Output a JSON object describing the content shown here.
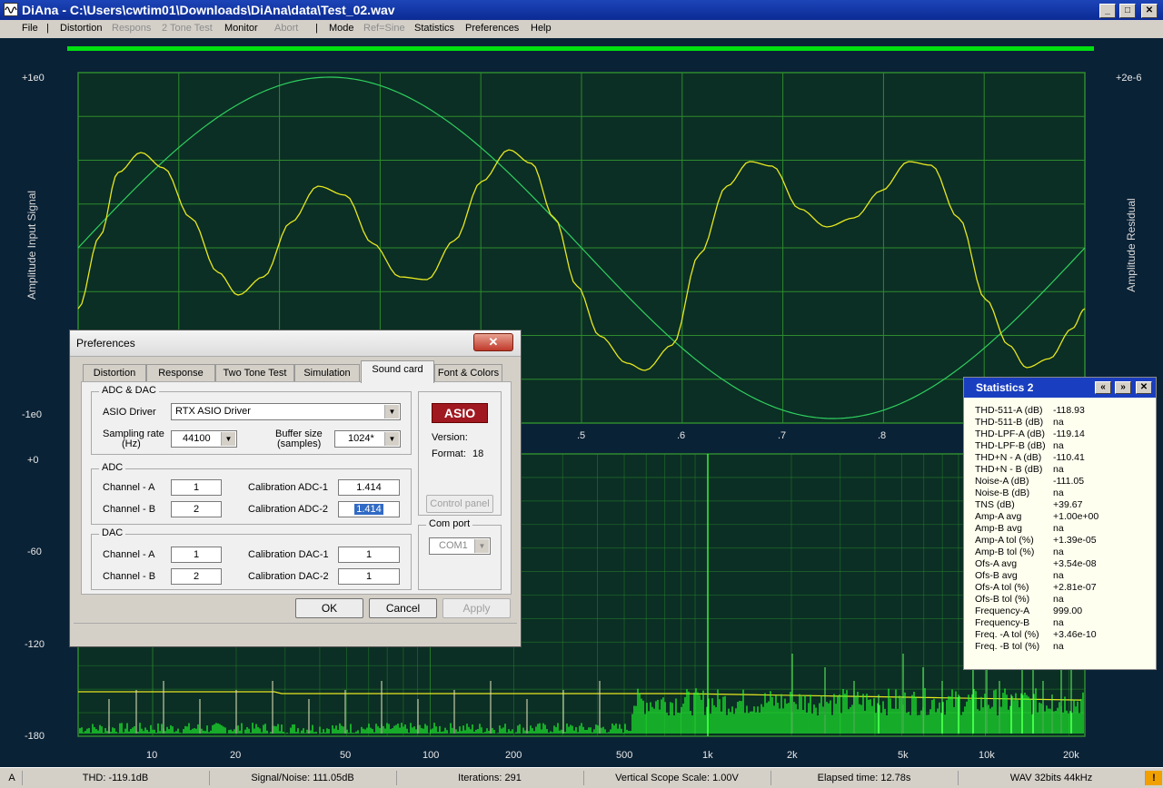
{
  "window": {
    "title": "DiAna - C:\\Users\\cwtim01\\Downloads\\DiAna\\data\\Test_02.wav"
  },
  "menu": [
    {
      "label": "File",
      "enabled": true
    },
    {
      "label": "|",
      "enabled": true
    },
    {
      "label": "Distortion",
      "enabled": true
    },
    {
      "label": "Respons",
      "enabled": false
    },
    {
      "label": "2 Tone Test",
      "enabled": false
    },
    {
      "label": "Monitor",
      "enabled": true
    },
    {
      "label": "Abort",
      "enabled": false
    },
    {
      "label": "|",
      "enabled": true
    },
    {
      "label": "Mode",
      "enabled": true
    },
    {
      "label": "Ref=Sine",
      "enabled": false
    },
    {
      "label": "Statistics",
      "enabled": true
    },
    {
      "label": "Preferences",
      "enabled": true
    },
    {
      "label": "Help",
      "enabled": true
    }
  ],
  "scope": {
    "y_top": "+1e0",
    "y_bottom": "-1e0",
    "y_right_top": "+2e-6",
    "left_label": "Amplitude Input Signal",
    "right_label": "Amplitude Residual",
    "x_ticks": [
      ".5",
      ".6",
      ".7",
      ".8"
    ]
  },
  "spectrum": {
    "y_ticks": [
      "+0",
      "-60",
      "-120",
      "-180"
    ],
    "x_ticks": [
      "10",
      "20",
      "50",
      "100",
      "200",
      "500",
      "1k",
      "2k",
      "5k",
      "10k",
      "20k"
    ]
  },
  "preferences": {
    "title": "Preferences",
    "tabs": [
      "Distortion",
      "Response",
      "Two Tone Test",
      "Simulation",
      "Sound card",
      "Font & Colors"
    ],
    "active_tab": "Sound card",
    "adc_dac_group": "ADC & DAC",
    "asio_driver_label": "ASIO Driver",
    "asio_driver_value": "RTX ASIO Driver",
    "sampling_rate_label": "Sampling rate",
    "sampling_rate_unit": "(Hz)",
    "sampling_rate_value": "44100",
    "buffer_size_label": "Buffer size",
    "buffer_size_unit": "(samples)",
    "buffer_size_value": "1024*",
    "adc_group": "ADC",
    "adc_channel_a_label": "Channel - A",
    "adc_channel_a_value": "1",
    "adc_channel_b_label": "Channel - B",
    "adc_channel_b_value": "2",
    "cal_adc1_label": "Calibration ADC-1",
    "cal_adc1_value": "1.414",
    "cal_adc2_label": "Calibration ADC-2",
    "cal_adc2_value": "1.414",
    "dac_group": "DAC",
    "dac_channel_a_label": "Channel - A",
    "dac_channel_a_value": "1",
    "dac_channel_b_label": "Channel - B",
    "dac_channel_b_value": "2",
    "cal_dac1_label": "Calibration DAC-1",
    "cal_dac1_value": "1",
    "cal_dac2_label": "Calibration DAC-2",
    "cal_dac2_value": "1",
    "asio_logo": "ASIO",
    "version_label": "Version:",
    "format_label": "Format:",
    "format_value": "18",
    "control_panel_label": "Control panel",
    "com_port_label": "Com port",
    "com_port_value": "COM1",
    "ok_label": "OK",
    "cancel_label": "Cancel",
    "apply_label": "Apply"
  },
  "statistics": {
    "title": "Statistics 2",
    "rows": [
      {
        "k": "THD-511-A (dB)",
        "v": "-118.93"
      },
      {
        "k": "THD-511-B (dB)",
        "v": "na"
      },
      {
        "k": "THD-LPF-A (dB)",
        "v": "-119.14"
      },
      {
        "k": "THD-LPF-B (dB)",
        "v": "na"
      },
      {
        "k": "THD+N - A (dB)",
        "v": "-110.41"
      },
      {
        "k": "THD+N - B (dB)",
        "v": "na"
      },
      {
        "k": "Noise-A (dB)",
        "v": "-111.05"
      },
      {
        "k": "Noise-B (dB)",
        "v": "na"
      },
      {
        "k": "TNS (dB)",
        "v": "+39.67"
      },
      {
        "k": "Amp-A avg",
        "v": "+1.00e+00"
      },
      {
        "k": "Amp-B avg",
        "v": "na"
      },
      {
        "k": "Amp-A tol (%)",
        "v": "+1.39e-05"
      },
      {
        "k": "Amp-B tol (%)",
        "v": "na"
      },
      {
        "k": "Ofs-A avg",
        "v": "+3.54e-08"
      },
      {
        "k": "Ofs-B avg",
        "v": "na"
      },
      {
        "k": "Ofs-A tol (%)",
        "v": "+2.81e-07"
      },
      {
        "k": "Ofs-B tol (%)",
        "v": "na"
      },
      {
        "k": "Frequency-A",
        "v": "999.00"
      },
      {
        "k": "Frequency-B",
        "v": "na"
      },
      {
        "k": "Freq. -A  tol (%)",
        "v": "+3.46e-10"
      },
      {
        "k": "Freq. -B  tol (%)",
        "v": "na"
      }
    ]
  },
  "status": {
    "channel": "A",
    "thd": "THD: -119.1dB",
    "snr": "Signal/Noise: 111.05dB",
    "iterations": "Iterations: 291",
    "scope_scale": "Vertical Scope Scale: 1.00V",
    "elapsed": "Elapsed time: 12.78s",
    "format": "WAV 32bits 44kHz",
    "warning": "!"
  },
  "colors": {
    "background": "#0a2236",
    "plot_bg": "#0b2f24",
    "grid": "#2e8a2e",
    "signal_yellow": "#e8e820",
    "sine_green": "#30d060",
    "spectrum_green": "#20ff30",
    "progress": "#00e010",
    "title_blue": "#0b2a94"
  }
}
